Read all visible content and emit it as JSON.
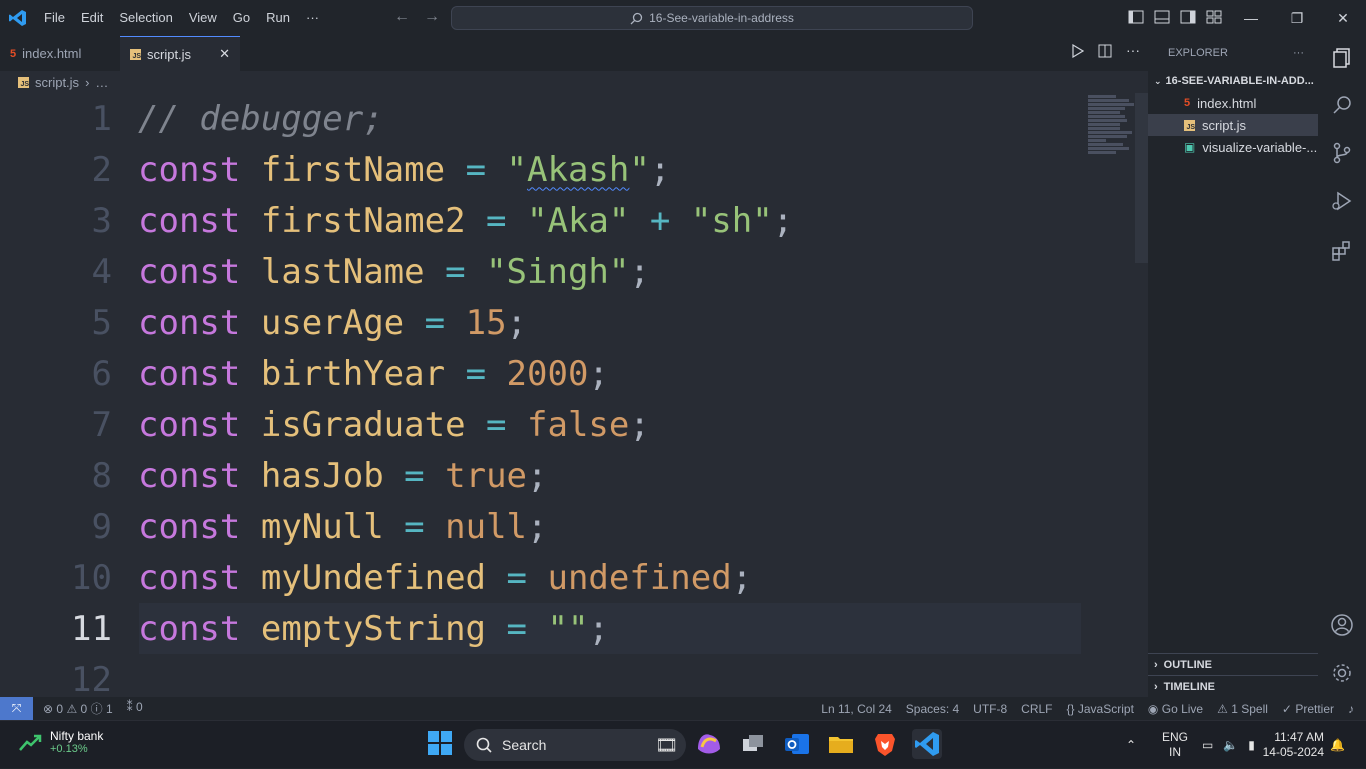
{
  "menu": [
    "File",
    "Edit",
    "Selection",
    "View",
    "Go",
    "Run",
    "···"
  ],
  "command_center": "16-See-variable-in-address",
  "tabs": [
    {
      "label": "index.html",
      "icon": "html-icon"
    },
    {
      "label": "script.js",
      "icon": "js-icon",
      "close": "✕"
    }
  ],
  "breadcrumbs": {
    "file": "script.js",
    "rest": "…"
  },
  "editor": {
    "lines": [
      {
        "n": "1",
        "tokens": [
          [
            "cmt",
            "// debugger;"
          ]
        ]
      },
      {
        "n": "2",
        "tokens": [
          [
            "kw",
            "const"
          ],
          [
            "pun",
            " "
          ],
          [
            "var",
            "firstName"
          ],
          [
            "pun",
            " "
          ],
          [
            "op",
            "="
          ],
          [
            "pun",
            " "
          ],
          [
            "str",
            "\""
          ],
          [
            "strsq",
            "Akash"
          ],
          [
            "str",
            "\""
          ],
          [
            "pun",
            ";"
          ]
        ]
      },
      {
        "n": "3",
        "tokens": [
          [
            "kw",
            "const"
          ],
          [
            "pun",
            " "
          ],
          [
            "var",
            "firstName2"
          ],
          [
            "pun",
            " "
          ],
          [
            "op",
            "="
          ],
          [
            "pun",
            " "
          ],
          [
            "str",
            "\"Aka\""
          ],
          [
            "pun",
            " "
          ],
          [
            "op",
            "+"
          ],
          [
            "pun",
            " "
          ],
          [
            "str",
            "\"sh\""
          ],
          [
            "pun",
            ";"
          ]
        ]
      },
      {
        "n": "4",
        "tokens": [
          [
            "kw",
            "const"
          ],
          [
            "pun",
            " "
          ],
          [
            "var",
            "lastName"
          ],
          [
            "pun",
            " "
          ],
          [
            "op",
            "="
          ],
          [
            "pun",
            " "
          ],
          [
            "str",
            "\"Singh\""
          ],
          [
            "pun",
            ";"
          ]
        ]
      },
      {
        "n": "5",
        "tokens": [
          [
            "kw",
            "const"
          ],
          [
            "pun",
            " "
          ],
          [
            "var",
            "userAge"
          ],
          [
            "pun",
            " "
          ],
          [
            "op",
            "="
          ],
          [
            "pun",
            " "
          ],
          [
            "num",
            "15"
          ],
          [
            "pun",
            ";"
          ]
        ]
      },
      {
        "n": "6",
        "tokens": [
          [
            "kw",
            "const"
          ],
          [
            "pun",
            " "
          ],
          [
            "var",
            "birthYear"
          ],
          [
            "pun",
            " "
          ],
          [
            "op",
            "="
          ],
          [
            "pun",
            " "
          ],
          [
            "num",
            "2000"
          ],
          [
            "pun",
            ";"
          ]
        ]
      },
      {
        "n": "7",
        "tokens": [
          [
            "kw",
            "const"
          ],
          [
            "pun",
            " "
          ],
          [
            "var",
            "isGraduate"
          ],
          [
            "pun",
            " "
          ],
          [
            "op",
            "="
          ],
          [
            "pun",
            " "
          ],
          [
            "num",
            "false"
          ],
          [
            "pun",
            ";"
          ]
        ]
      },
      {
        "n": "8",
        "tokens": [
          [
            "kw",
            "const"
          ],
          [
            "pun",
            " "
          ],
          [
            "var",
            "hasJob"
          ],
          [
            "pun",
            " "
          ],
          [
            "op",
            "="
          ],
          [
            "pun",
            " "
          ],
          [
            "num",
            "true"
          ],
          [
            "pun",
            ";"
          ]
        ]
      },
      {
        "n": "9",
        "tokens": [
          [
            "kw",
            "const"
          ],
          [
            "pun",
            " "
          ],
          [
            "var",
            "myNull"
          ],
          [
            "pun",
            " "
          ],
          [
            "op",
            "="
          ],
          [
            "pun",
            " "
          ],
          [
            "num",
            "null"
          ],
          [
            "pun",
            ";"
          ]
        ]
      },
      {
        "n": "10",
        "tokens": [
          [
            "kw",
            "const"
          ],
          [
            "pun",
            " "
          ],
          [
            "var",
            "myUndefined"
          ],
          [
            "pun",
            " "
          ],
          [
            "op",
            "="
          ],
          [
            "pun",
            " "
          ],
          [
            "num",
            "undefined"
          ],
          [
            "pun",
            ";"
          ]
        ]
      },
      {
        "n": "11",
        "tokens": [
          [
            "kw",
            "const"
          ],
          [
            "pun",
            " "
          ],
          [
            "var",
            "emptyString"
          ],
          [
            "pun",
            " "
          ],
          [
            "op",
            "="
          ],
          [
            "pun",
            " "
          ],
          [
            "str",
            "\"\""
          ],
          [
            "pun",
            ";"
          ]
        ],
        "current": true
      },
      {
        "n": "12",
        "tokens": []
      }
    ]
  },
  "explorer": {
    "title": "EXPLORER",
    "more": "···",
    "folder": "16-SEE-VARIABLE-IN-ADD...",
    "files": [
      {
        "label": "index.html",
        "type": "html"
      },
      {
        "label": "script.js",
        "type": "js",
        "selected": true
      },
      {
        "label": "visualize-variable-...",
        "type": "img"
      }
    ],
    "outline": "OUTLINE",
    "timeline": "TIMELINE"
  },
  "status": {
    "errors": "0",
    "warnings": "0",
    "info": "1",
    "ports": "0",
    "position": "Ln 11, Col 24",
    "spaces": "Spaces: 4",
    "encoding": "UTF-8",
    "eol": "CRLF",
    "language": "JavaScript",
    "golive": "Go Live",
    "spell": "1 Spell",
    "prettier": "Prettier"
  },
  "taskbar": {
    "widget_title": "Nifty bank",
    "widget_value": "+0.13%",
    "search": "Search",
    "lang1": "ENG",
    "lang2": "IN",
    "time": "11:47 AM",
    "date": "14-05-2024"
  },
  "colors": {
    "accent": "#4d78cc",
    "keyword": "#c678dd",
    "variable": "#e5c07b",
    "string": "#98c379",
    "number": "#d19a66",
    "operator": "#56b6c2"
  }
}
